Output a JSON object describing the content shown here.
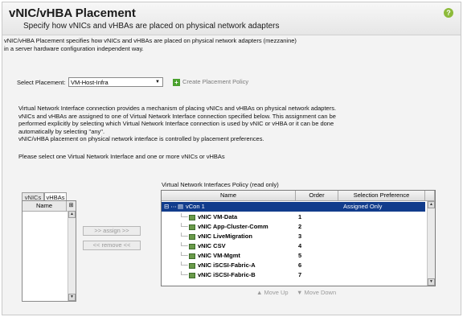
{
  "header": {
    "title": "vNIC/vHBA Placement",
    "subtitle": "Specify how vNICs and vHBAs are placed on physical network adapters"
  },
  "description": {
    "line1": "vNIC/vHBA Placement specifies how vNICs and vHBAs are placed on physical network adapters (mezzanine)",
    "line2": "in a server hardware configuration independent way."
  },
  "placement": {
    "label": "Select Placement:",
    "value": "VM-Host-Infra",
    "create_label": "Create Placement Policy"
  },
  "info": {
    "line1": "Virtual Network Interface connection provides a mechanism of placing vNICs and vHBAs on physical network adapters.",
    "line2": "vNICs and vHBAs are assigned to one of Virtual Network Interface connection specified below. This assignment can be",
    "line3": "performed explicitly by selecting which Virtual Network Interface connection is used by vNIC or vHBA or it can be done",
    "line4": "automatically by selecting \"any\".",
    "line5": "vNIC/vHBA placement on physical network interface is controlled by placement preferences.",
    "instruction": "Please select one Virtual Network Interface and one or more vNICs or vHBAs"
  },
  "left_panel": {
    "tabs": [
      "vNICs",
      "vHBAs"
    ],
    "active_tab": "vHBAs",
    "column_header": "Name"
  },
  "buttons": {
    "assign": ">> assign >>",
    "remove": "<< remove <<"
  },
  "policy_table": {
    "title": "Virtual Network Interfaces Policy (read only)",
    "columns": [
      "Name",
      "Order",
      "Selection Preference"
    ],
    "group": {
      "name": "vCon 1",
      "preference": "Assigned Only"
    },
    "rows": [
      {
        "name": "vNIC VM-Data",
        "order": "1"
      },
      {
        "name": "vNIC App-Cluster-Comm",
        "order": "2"
      },
      {
        "name": "vNIC LiveMigration",
        "order": "3"
      },
      {
        "name": "vNIC CSV",
        "order": "4"
      },
      {
        "name": "vNIC VM-Mgmt",
        "order": "5"
      },
      {
        "name": "vNIC iSCSI-Fabric-A",
        "order": "6"
      },
      {
        "name": "vNIC iSCSI-Fabric-B",
        "order": "7"
      }
    ]
  },
  "move": {
    "up": "Move Up",
    "down": "Move Down"
  }
}
